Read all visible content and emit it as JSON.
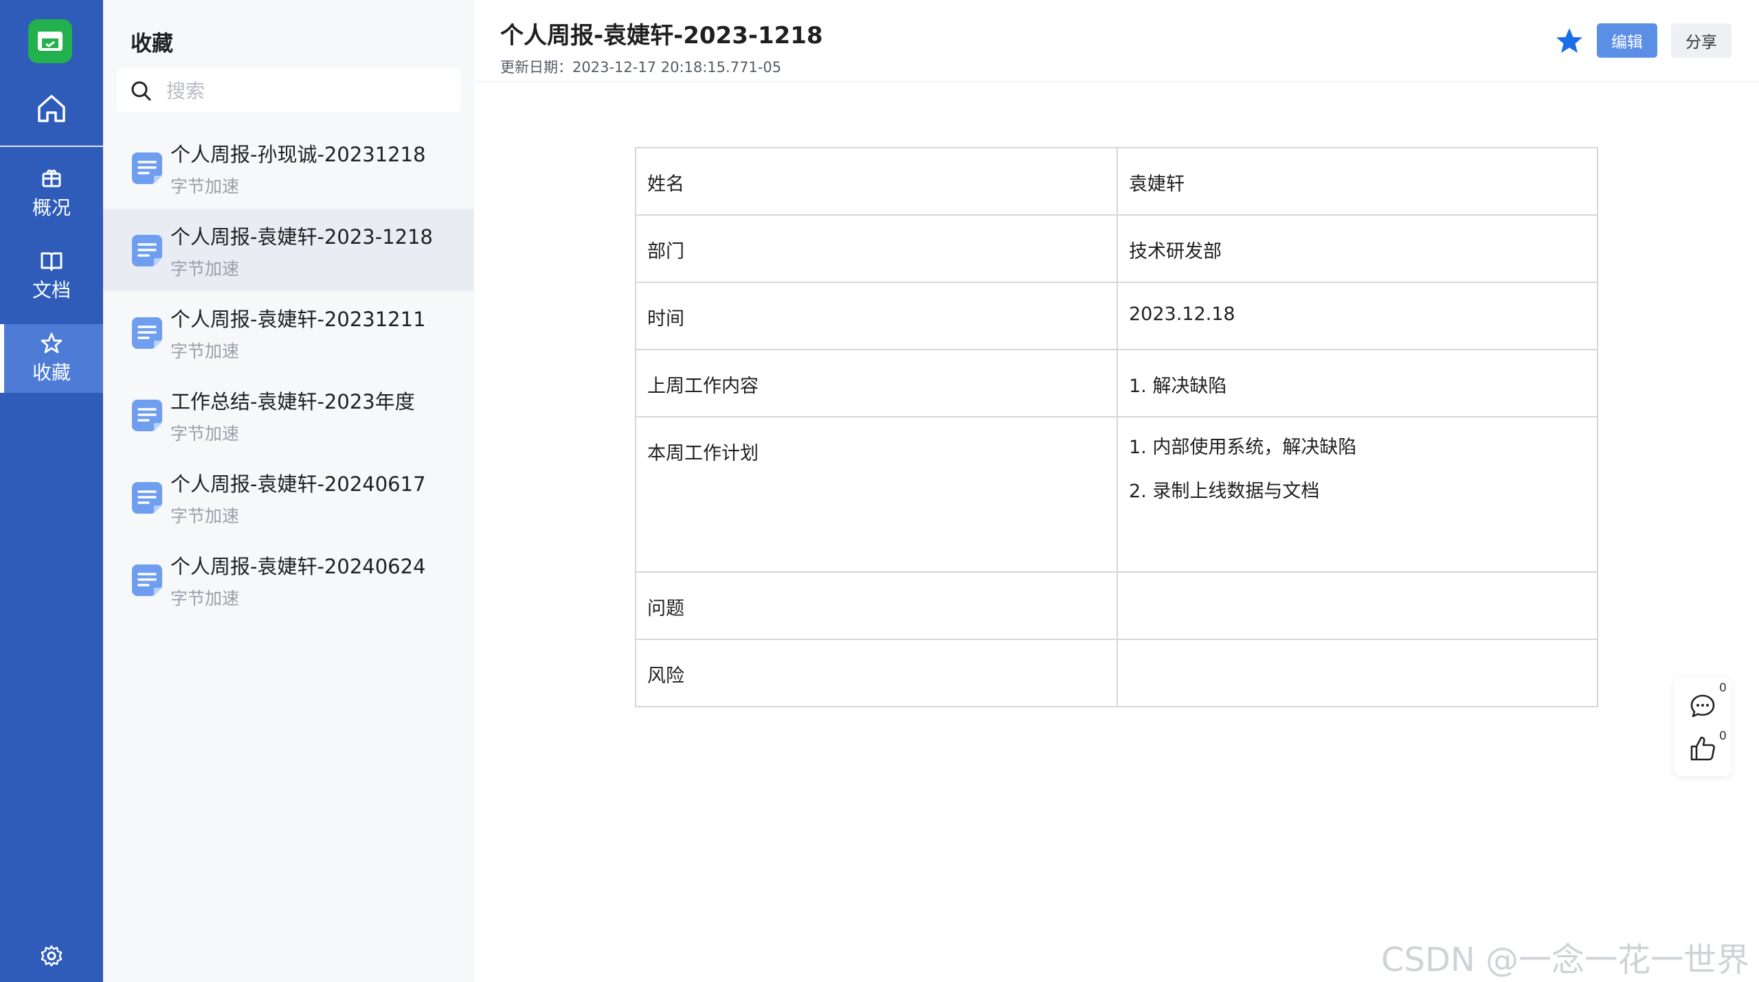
{
  "rail": {
    "items": [
      {
        "label": "概况",
        "icon": "package-icon"
      },
      {
        "label": "文档",
        "icon": "book-icon"
      },
      {
        "label": "收藏",
        "icon": "star-icon"
      }
    ]
  },
  "panel": {
    "title": "收藏",
    "search_placeholder": "搜索",
    "items": [
      {
        "name": "个人周报-孙现诚-20231218",
        "sub": "字节加速"
      },
      {
        "name": "个人周报-袁婕轩-2023-1218",
        "sub": "字节加速"
      },
      {
        "name": "个人周报-袁婕轩-20231211",
        "sub": "字节加速"
      },
      {
        "name": "工作总结-袁婕轩-2023年度",
        "sub": "字节加速"
      },
      {
        "name": "个人周报-袁婕轩-20240617",
        "sub": "字节加速"
      },
      {
        "name": "个人周报-袁婕轩-20240624",
        "sub": "字节加速"
      }
    ]
  },
  "header": {
    "title": "个人周报-袁婕轩-2023-1218",
    "updated": "更新日期：2023-12-17 20:18:15.771-05",
    "edit_label": "编辑",
    "share_label": "分享"
  },
  "table": {
    "rows": [
      {
        "key": "姓名",
        "value": [
          "袁婕轩"
        ]
      },
      {
        "key": "部门",
        "value": [
          "技术研发部"
        ]
      },
      {
        "key": "时间",
        "value": [
          "2023.12.18"
        ]
      },
      {
        "key": "上周工作内容",
        "value": [
          "1. 解决缺陷"
        ]
      },
      {
        "key": "本周工作计划",
        "value": [
          "1. 内部使用系统，解决缺陷",
          "2. 录制上线数据与文档"
        ]
      },
      {
        "key": "问题",
        "value": []
      },
      {
        "key": "风险",
        "value": []
      }
    ]
  },
  "float": {
    "comment_count": "0",
    "like_count": "0"
  },
  "watermark": "CSDN @一念一花一世界",
  "colors": {
    "rail": "#2e5cb8",
    "accent": "#1a6fe8",
    "logo": "#22b14c"
  }
}
